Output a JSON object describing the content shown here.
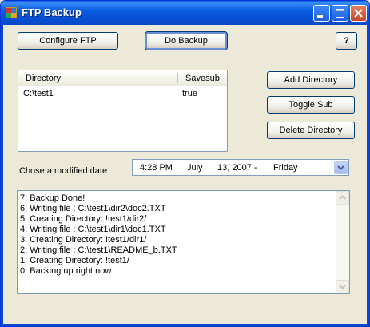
{
  "window": {
    "title": "FTP Backup",
    "icon": "ftp-app-icon",
    "controls": [
      "minimize-icon",
      "maximize-icon",
      "close-icon"
    ]
  },
  "buttons": {
    "configure_ftp": "Configure FTP",
    "do_backup": "Do Backup",
    "help": "?",
    "add_directory": "Add Directory",
    "toggle_sub": "Toggle Sub",
    "delete_directory": "Delete Directory"
  },
  "directories": {
    "columns": [
      "Directory",
      "Savesub"
    ],
    "rows": [
      {
        "directory": "C:\\test1",
        "savesub": "true"
      }
    ]
  },
  "date_picker": {
    "label": "Chose a modified date",
    "time": "4:28 PM",
    "month": "July",
    "day_year": "13, 2007 -",
    "weekday": "Friday"
  },
  "log": [
    "7: Backup Done!",
    "6: Writing file : C:\\test1\\dir2\\doc2.TXT",
    "5: Creating Directory: !test1/dir2/",
    "4: Writing file : C:\\test1\\dir1\\doc1.TXT",
    "3: Creating Directory: !test1/dir1/",
    "2: Writing file : C:\\test1\\README_b.TXT",
    "1: Creating Directory: !test1/",
    "0: Backing up right now"
  ],
  "colors": {
    "titlebar": "#0a5fdc",
    "face": "#ece9d8",
    "border": "#7f9db9"
  }
}
